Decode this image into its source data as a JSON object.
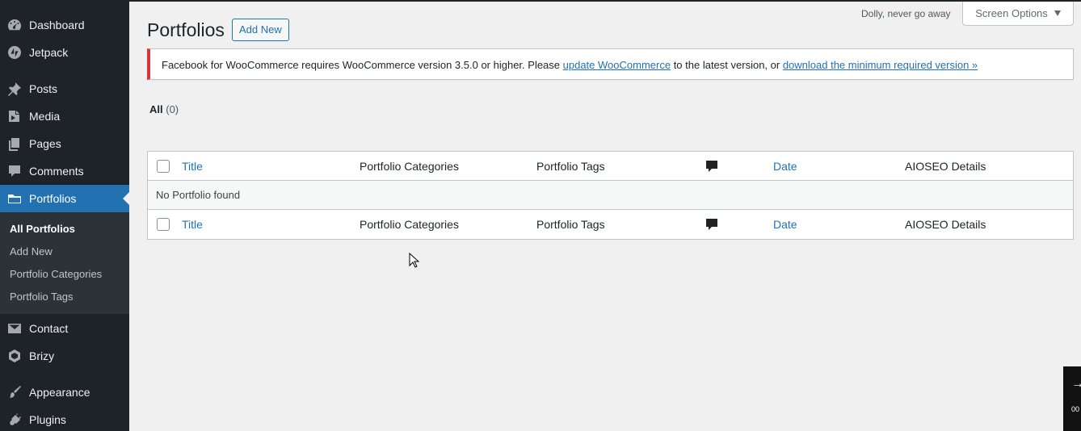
{
  "sidebar": {
    "items": [
      {
        "label": "Dashboard",
        "icon": "dashboard-icon"
      },
      {
        "label": "Jetpack",
        "icon": "jetpack-icon"
      },
      {
        "label": "Posts",
        "icon": "pin-icon"
      },
      {
        "label": "Media",
        "icon": "media-icon"
      },
      {
        "label": "Pages",
        "icon": "pages-icon"
      },
      {
        "label": "Comments",
        "icon": "comments-icon"
      },
      {
        "label": "Portfolios",
        "icon": "folder-icon",
        "current": true
      },
      {
        "label": "Contact",
        "icon": "mail-icon"
      },
      {
        "label": "Brizy",
        "icon": "brizy-icon"
      },
      {
        "label": "Appearance",
        "icon": "brush-icon"
      },
      {
        "label": "Plugins",
        "icon": "plug-icon"
      }
    ],
    "submenu": [
      {
        "label": "All Portfolios",
        "current": true
      },
      {
        "label": "Add New"
      },
      {
        "label": "Portfolio Categories"
      },
      {
        "label": "Portfolio Tags"
      }
    ]
  },
  "header": {
    "title": "Portfolios",
    "add_new_label": "Add New",
    "dolly_text": "Dolly, never go away",
    "screen_options_label": "Screen Options"
  },
  "notice": {
    "text_before": "Facebook for WooCommerce requires WooCommerce version 3.5.0 or higher. Please ",
    "link1": "update WooCommerce",
    "text_middle": " to the latest version, or ",
    "link2": "download the minimum required version »"
  },
  "filters": {
    "all_label": "All",
    "all_count": "(0)"
  },
  "table": {
    "columns": {
      "title": "Title",
      "categories": "Portfolio Categories",
      "tags": "Portfolio Tags",
      "date": "Date",
      "aioseo": "AIOSEO Details"
    },
    "empty_message": "No Portfolio found"
  },
  "overlay": {
    "time_text": "00"
  },
  "colors": {
    "sidebar_bg": "#1d2327",
    "accent": "#2271b1",
    "notice_error": "#d63638",
    "page_bg": "#f0f0f1"
  }
}
